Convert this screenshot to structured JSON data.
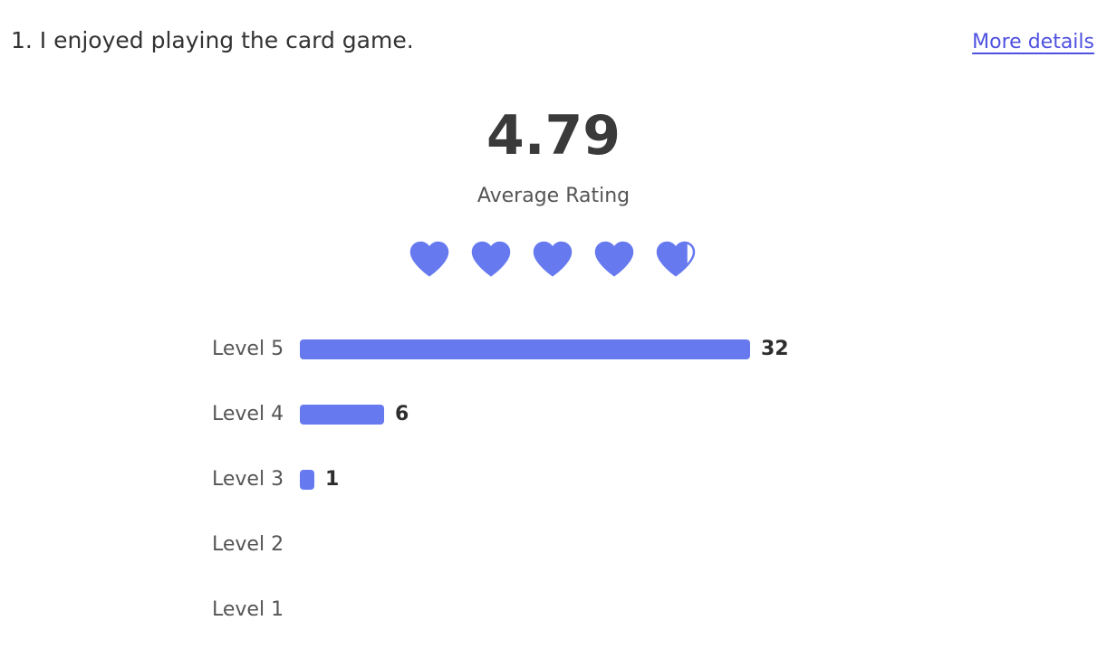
{
  "question": {
    "text": "1. I enjoyed playing the card game."
  },
  "links": {
    "more_details": "More details"
  },
  "rating": {
    "average": "4.79",
    "label": "Average Rating",
    "max_hearts": 5,
    "average_value": 4.79,
    "icon": "heart-icon",
    "accent_color": "#6679ef"
  },
  "distribution": {
    "max_count": 32,
    "rows": [
      {
        "label": "Level 5",
        "count": 32,
        "count_label": "32"
      },
      {
        "label": "Level 4",
        "count": 6,
        "count_label": "6"
      },
      {
        "label": "Level 3",
        "count": 1,
        "count_label": "1"
      },
      {
        "label": "Level 2",
        "count": 0,
        "count_label": ""
      },
      {
        "label": "Level 1",
        "count": 0,
        "count_label": ""
      }
    ]
  }
}
